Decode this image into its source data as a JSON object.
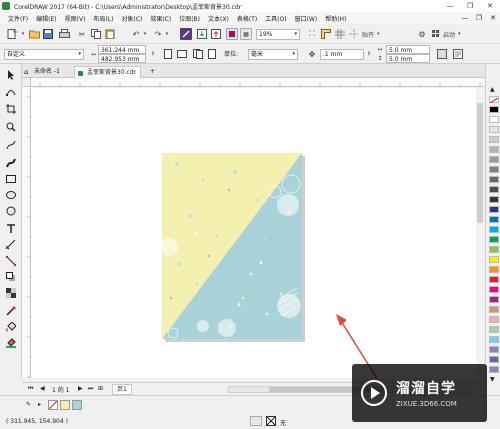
{
  "window": {
    "title": "CorelDRAW 2017 (64-Bit) - C:\\Users\\Administrator\\Desktop\\孟菲斯背景30.cdr",
    "controls": [
      "—",
      "❐",
      "✕"
    ]
  },
  "menu": {
    "items": [
      "文件(F)",
      "编辑(E)",
      "视图(V)",
      "布局(L)",
      "对象(C)",
      "效果(C)",
      "位图(B)",
      "文本(X)",
      "表格(T)",
      "工具(O)",
      "窗口(W)",
      "帮助(H)"
    ],
    "doc_controls": [
      "—",
      "❐",
      "✕"
    ]
  },
  "toolbar": {
    "zoom": "19%",
    "snap_label": "贴齐",
    "launch_label": "启动"
  },
  "property_bar": {
    "page_size": "自定义",
    "width": "361.244 mm",
    "height": "482.953 mm",
    "units_label": "单位:",
    "units_value": "毫米",
    "nudge": ".1 mm",
    "dup_x": "5.0 mm",
    "dup_y": "5.0 mm"
  },
  "tabs": {
    "untitled": "未命名 -1",
    "active": "孟菲斯背景30.cdr",
    "add": "+"
  },
  "page_nav": {
    "counter": "1 的 1",
    "page_tab": "页1"
  },
  "status": {
    "coordinates": "( 311.945, 154.904 )",
    "fill_none": "无"
  },
  "watermark": {
    "brand": "溜溜自学",
    "url": "ZIXUE.3D66.COM"
  },
  "colors": {
    "design_yellow": "#f3f0b0",
    "design_blue": "#a9d3d8",
    "arrow": "#e04a3c",
    "canvas_bg": "#ffffff"
  }
}
